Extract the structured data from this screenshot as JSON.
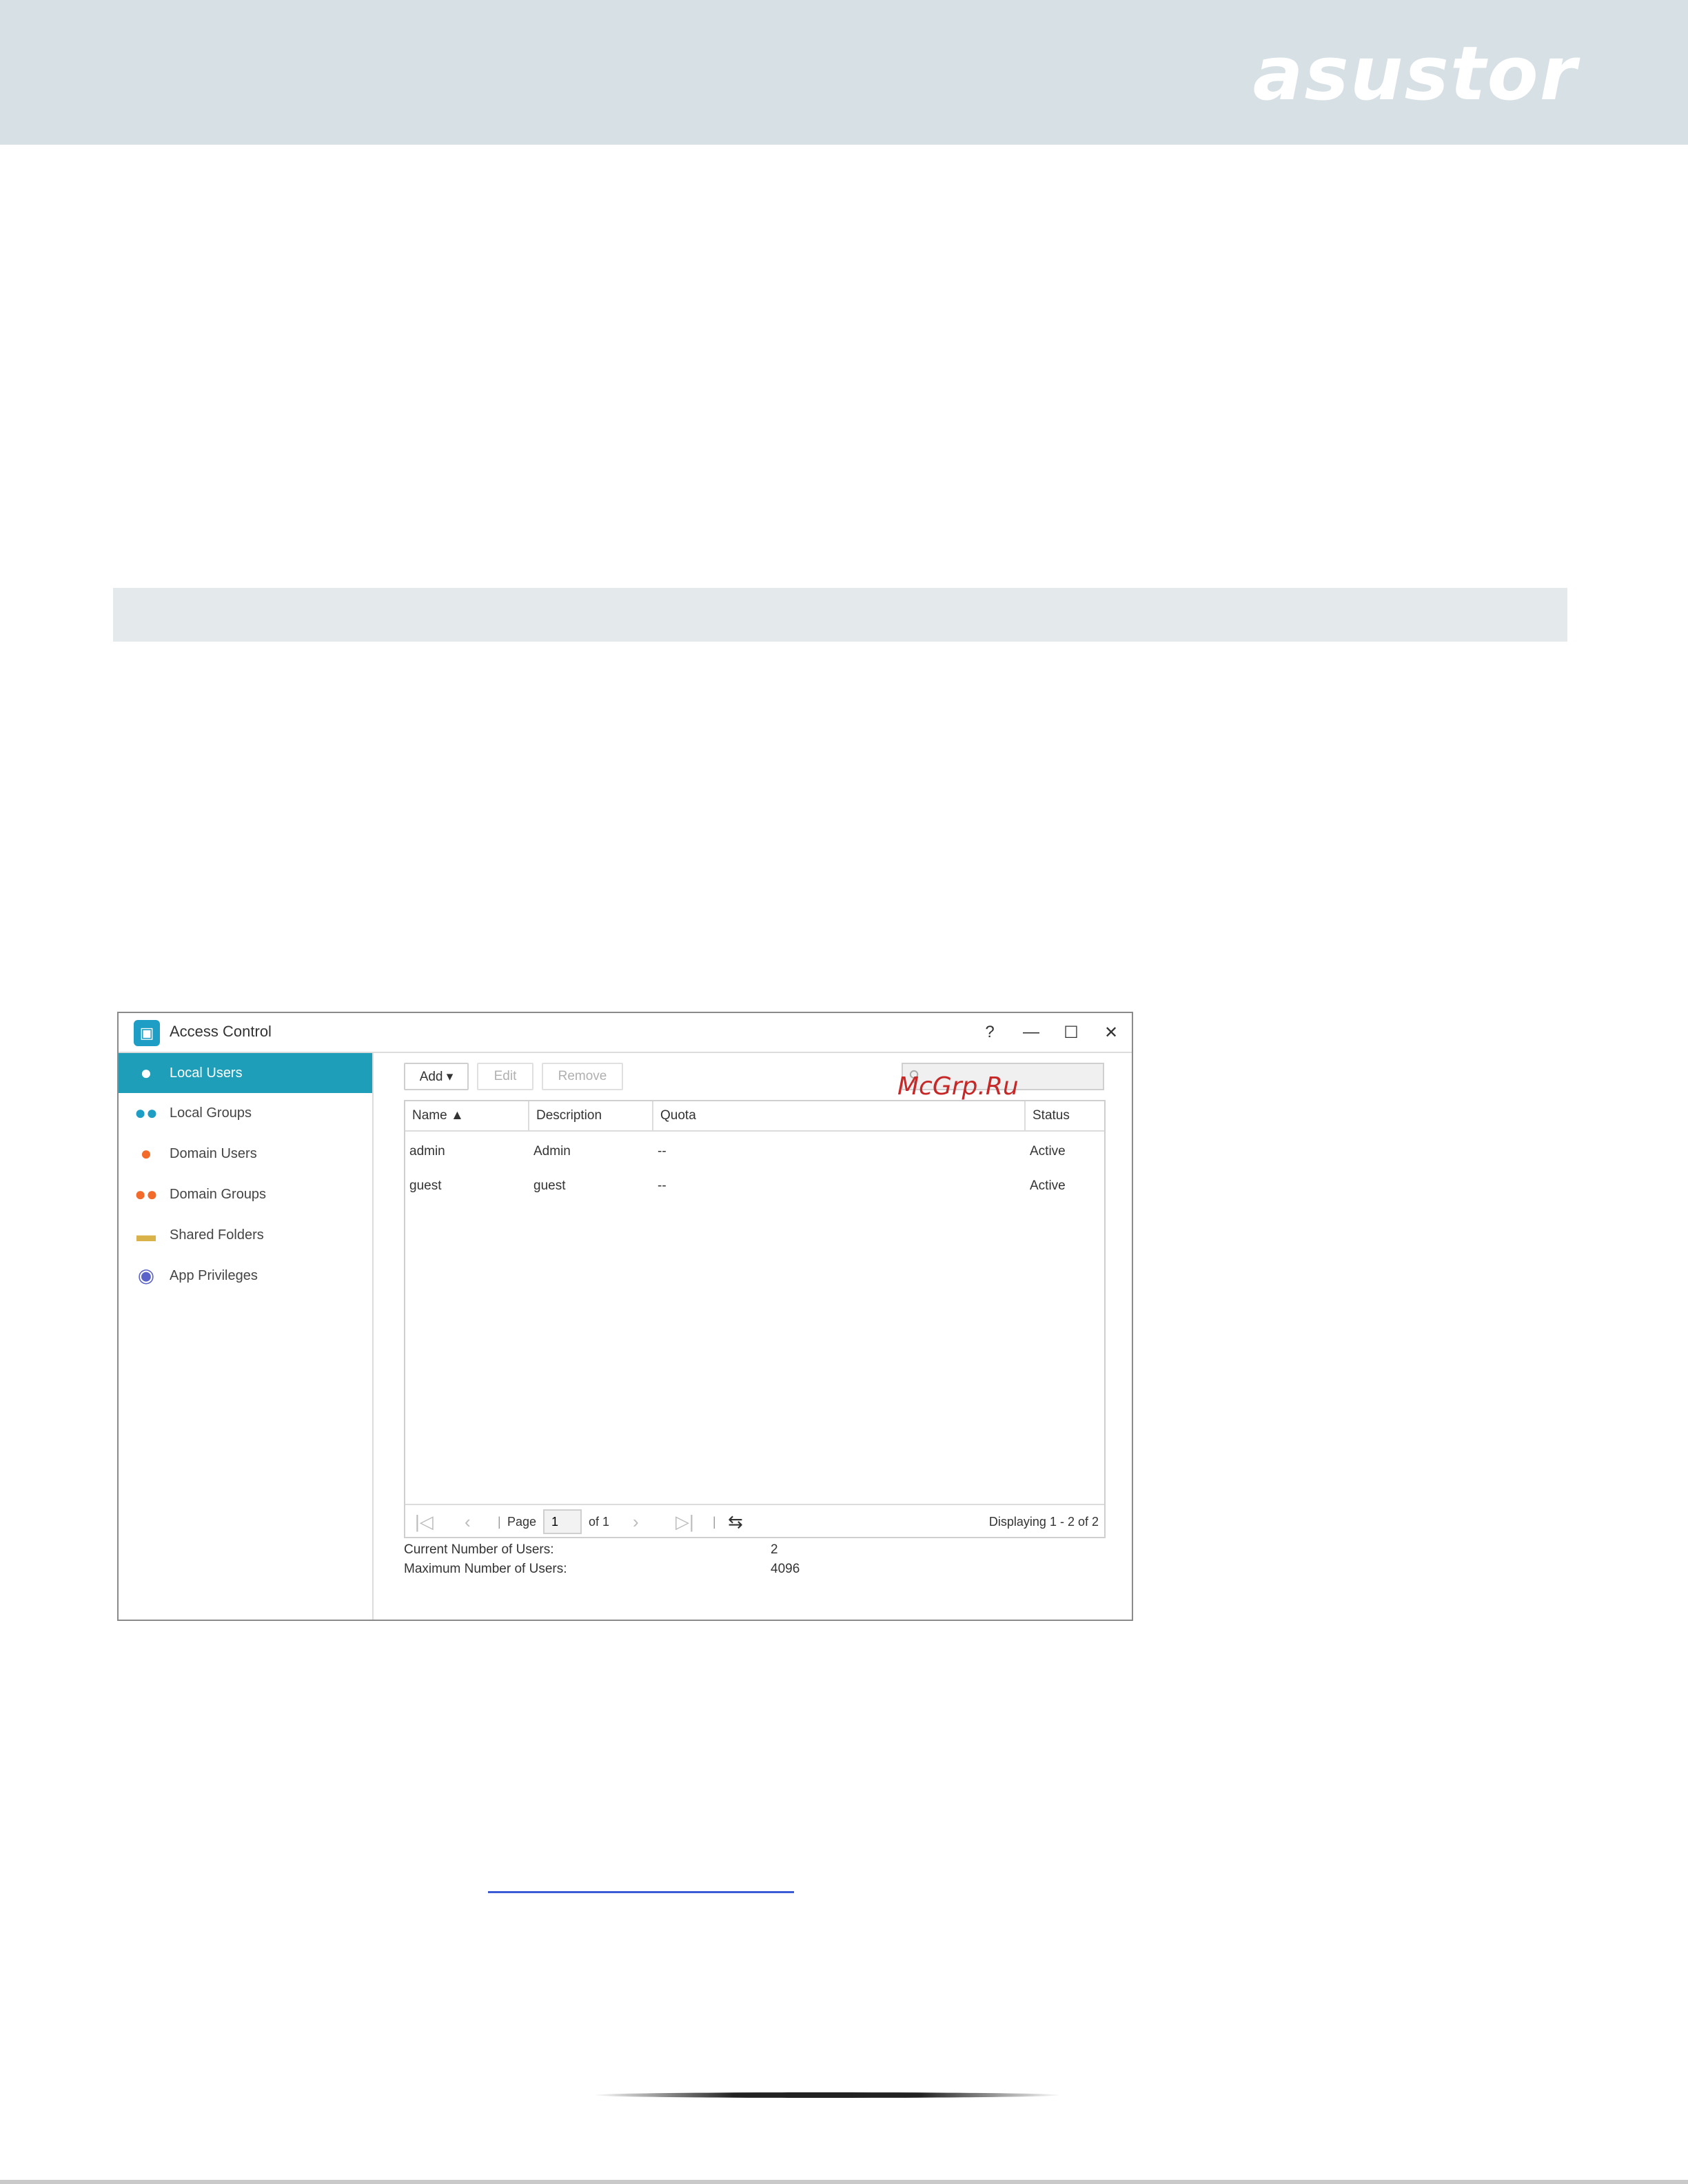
{
  "brand": {
    "logo_text": "asustor"
  },
  "window": {
    "title": "Access Control",
    "controls": {
      "help": "?",
      "minimize": "—",
      "maximize": "☐",
      "close": "✕"
    }
  },
  "sidebar": {
    "items": [
      {
        "label": "Local Users",
        "icon": "user-icon",
        "color": "#1e9ec4"
      },
      {
        "label": "Local Groups",
        "icon": "group-icon",
        "color": "#1e9ec4"
      },
      {
        "label": "Domain Users",
        "icon": "user-icon",
        "color": "#f26b2a"
      },
      {
        "label": "Domain Groups",
        "icon": "group-icon",
        "color": "#f26b2a"
      },
      {
        "label": "Shared Folders",
        "icon": "folder-icon",
        "color": "#d9b24a"
      },
      {
        "label": "App Privileges",
        "icon": "app-icon",
        "color": "#5b62c9"
      }
    ],
    "active_color": "#1f9eb9"
  },
  "toolbar": {
    "add_label": "Add ▾",
    "edit_label": "Edit",
    "remove_label": "Remove",
    "search_placeholder": ""
  },
  "watermark": "McGrp.Ru",
  "table": {
    "columns": [
      "Name ▲",
      "Description",
      "Quota",
      "Status"
    ],
    "rows": [
      [
        "admin",
        "Admin",
        "--",
        "Active"
      ],
      [
        "guest",
        "guest",
        "--",
        "Active"
      ]
    ]
  },
  "pager": {
    "first": "|◁",
    "prev": "‹",
    "page_label": "Page",
    "page_value": "1",
    "of_label": "of 1",
    "next": "›",
    "last": "▷|",
    "refresh": "⇆",
    "displaying": "Displaying 1 - 2 of 2"
  },
  "stats": {
    "current_label": "Current Number of Users:",
    "current_value": "2",
    "max_label": "Maximum Number of Users:",
    "max_value": "4096"
  }
}
